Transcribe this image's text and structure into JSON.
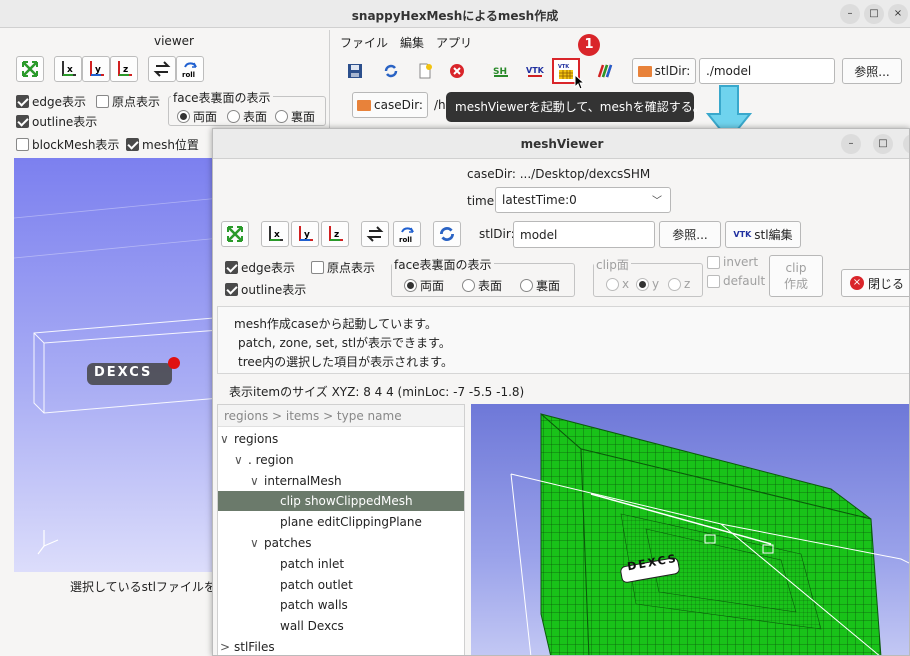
{
  "main_window": {
    "title": "snappyHexMeshによるmesh作成",
    "menu": [
      "ファイル",
      "編集",
      "アプリ"
    ],
    "viewer_label": "viewer",
    "checks": {
      "edge": "edge表示",
      "origin": "原点表示",
      "outline": "outline表示",
      "blockmesh": "blockMesh表示",
      "meshpos": "mesh位置"
    },
    "face_group": {
      "label": "face表裏面の表示",
      "both": "両面",
      "front": "表面",
      "back": "裏面"
    },
    "stl_label": "stlDir:",
    "stl_value": "./model",
    "browse": "参照...",
    "case_label": "caseDir:",
    "case_value": "/h",
    "badge": "1",
    "status_text": "選択しているstlファイルを"
  },
  "tooltip": "meshViewerを起動して、meshを確認する。",
  "mesh_viewer": {
    "title": "meshViewer",
    "case_dir": "caseDir: .../Desktop/dexcsSHM",
    "time_label": "time:",
    "time_value": "latestTime:0",
    "stl_label": "stlDir:",
    "stl_value": "model",
    "browse": "参照...",
    "stl_edit": "stl編集",
    "checks": {
      "edge": "edge表示",
      "origin": "原点表示",
      "outline": "outline表示"
    },
    "face_group": {
      "label": "face表裏面の表示",
      "both": "両面",
      "front": "表面",
      "back": "裏面"
    },
    "clip_group": {
      "label": "clip面",
      "x": "x",
      "y": "y",
      "z": "z"
    },
    "invert": "invert",
    "default": "default",
    "clip_btn": [
      "clip",
      "作成"
    ],
    "close": "閉じる",
    "message": [
      "mesh作成caseから起動しています。",
      "patch, zone, set, stlが表示できます。",
      "tree内の選択した項目が表示されます。"
    ],
    "size_text": "表示itemのサイズ XYZ: 8 4 4  (minLoc: -7 -5.5 -1.8)",
    "tree_header": "regions > items > type name",
    "tree": [
      {
        "text": "regions",
        "arrow": "∨"
      },
      {
        "text": ". region",
        "arrow": "∨"
      },
      {
        "text": "internalMesh",
        "arrow": "∨"
      },
      {
        "text": "clip  showClippedMesh",
        "arrow": ""
      },
      {
        "text": "plane editClippingPlane",
        "arrow": ""
      },
      {
        "text": "patches",
        "arrow": "∨"
      },
      {
        "text": "patch inlet",
        "arrow": ""
      },
      {
        "text": "patch outlet",
        "arrow": ""
      },
      {
        "text": "patch walls",
        "arrow": ""
      },
      {
        "text": "wall  Dexcs",
        "arrow": ""
      },
      {
        "text": "stlFiles",
        "arrow": ">"
      }
    ],
    "axis_labels": {
      "x": "x",
      "y": "y",
      "z": "z",
      "roll": "roll"
    },
    "model_text": "DEXCS"
  },
  "colors": {
    "mesh_green": "#19c219",
    "viewport_blue": "#7f86f0",
    "accent_red": "#d9252a",
    "tooltip_bg": "#333333",
    "selection": "#6b7a6b",
    "arrow_cyan": "#6fd3ee"
  },
  "icons": [
    "fit-icon",
    "x-axis-icon",
    "y-axis-icon",
    "z-axis-icon",
    "swap-icon",
    "roll-icon",
    "save-icon",
    "reload-icon",
    "new-icon",
    "stop-icon",
    "vtk-icon",
    "grid-icon",
    "color-icon"
  ]
}
